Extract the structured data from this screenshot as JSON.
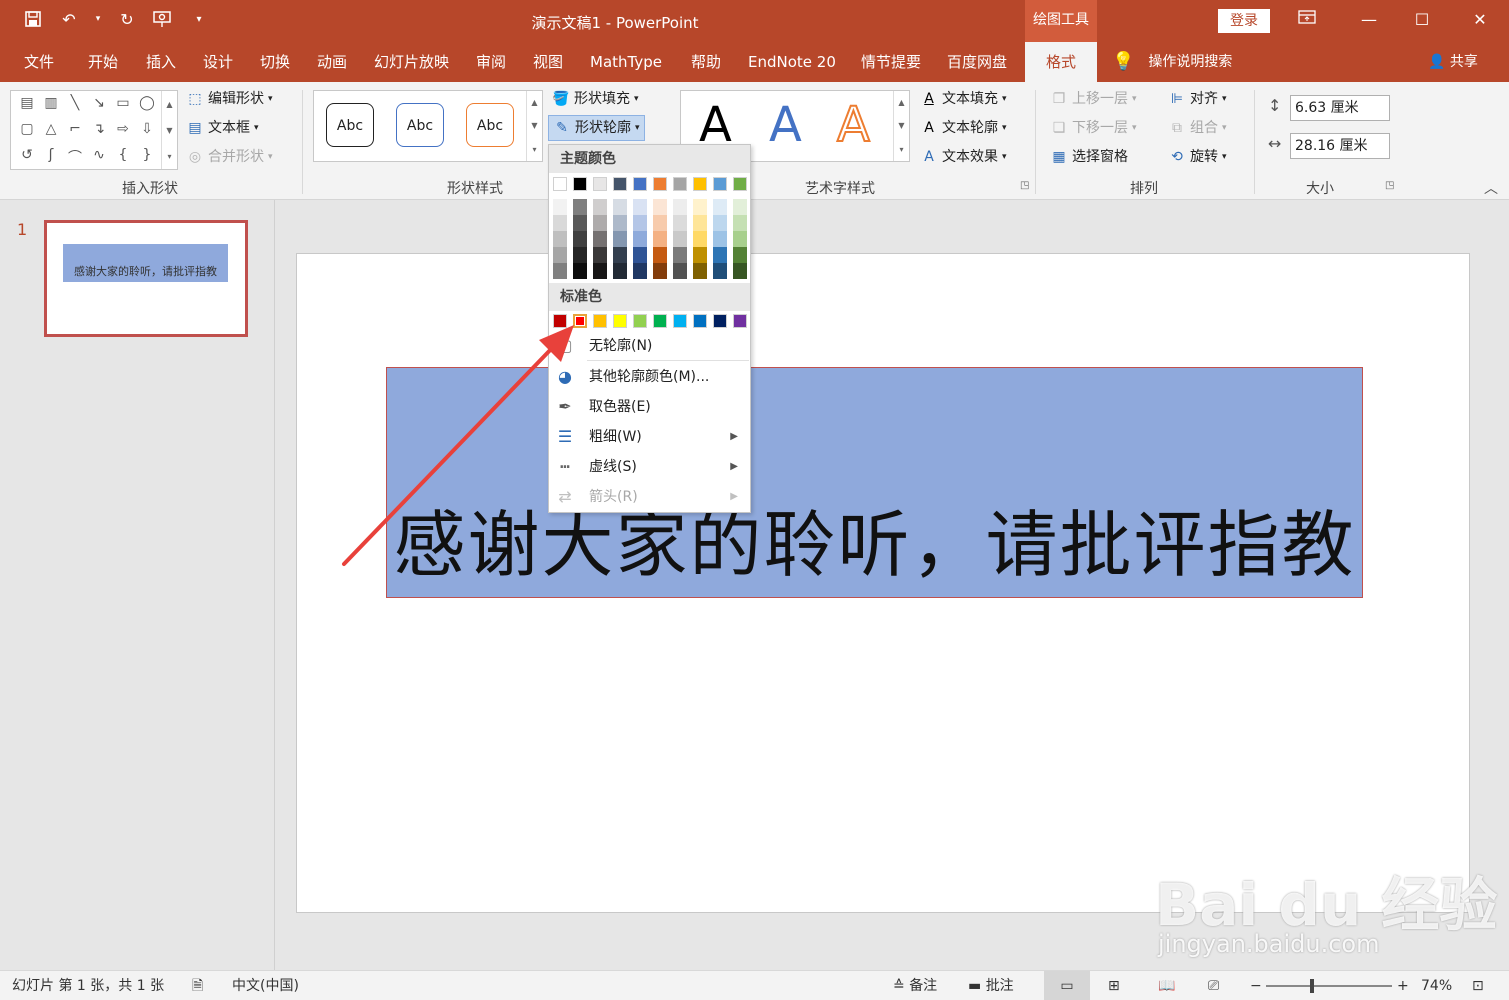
{
  "titlebar": {
    "title": "演示文稿1  -  PowerPoint",
    "context_tab_title": "绘图工具",
    "login": "登录"
  },
  "tabs": [
    "文件",
    "开始",
    "插入",
    "设计",
    "切换",
    "动画",
    "幻灯片放映",
    "审阅",
    "视图",
    "MathType",
    "帮助",
    "EndNote 20",
    "情节提要",
    "百度网盘",
    "格式"
  ],
  "active_tab": "格式",
  "tell_me": "操作说明搜索",
  "share": "共享",
  "ribbon": {
    "insert_shapes": {
      "label": "插入形状",
      "edit_shape": "编辑形状",
      "text_box": "文本框",
      "merge_shapes": "合并形状"
    },
    "shape_styles": {
      "label": "形状样式",
      "preset": "Abc",
      "fill": "形状填充",
      "outline": "形状轮廓"
    },
    "wordart": {
      "label": "艺术字样式",
      "letter": "A",
      "text_fill": "文本填充",
      "text_outline": "文本轮廓",
      "text_effects": "文本效果"
    },
    "arrange": {
      "label": "排列",
      "bring_forward": "上移一层",
      "send_backward": "下移一层",
      "selection_pane": "选择窗格",
      "align": "对齐",
      "group": "组合",
      "rotate": "旋转"
    },
    "size": {
      "label": "大小",
      "height": "6.63 厘米",
      "width": "28.16 厘米"
    }
  },
  "slides_pane": {
    "slide_number": "1",
    "thumb_text": "感谢大家的聆听，请批评指教"
  },
  "slide": {
    "text": "感谢大家的聆听，请批评指教"
  },
  "dropdown": {
    "theme_colors_header": "主题颜色",
    "standard_colors_header": "标准色",
    "theme_top": [
      "#ffffff",
      "#000000",
      "#e7e6e6",
      "#44546a",
      "#4472c4",
      "#ed7d31",
      "#a5a5a5",
      "#ffc000",
      "#5b9bd5",
      "#70ad47"
    ],
    "theme_shades": [
      [
        "#f2f2f2",
        "#d9d9d9",
        "#bfbfbf",
        "#a6a6a6",
        "#808080"
      ],
      [
        "#7f7f7f",
        "#595959",
        "#404040",
        "#262626",
        "#0d0d0d"
      ],
      [
        "#d0cece",
        "#aeabab",
        "#757171",
        "#3a3838",
        "#171616"
      ],
      [
        "#d6dce4",
        "#adb9ca",
        "#8497b0",
        "#333f4f",
        "#222a35"
      ],
      [
        "#d9e2f3",
        "#b4c6e7",
        "#8eaadb",
        "#2f5496",
        "#1f3864"
      ],
      [
        "#fbe5d5",
        "#f7cbac",
        "#f4b183",
        "#c55a11",
        "#833c0b"
      ],
      [
        "#ededed",
        "#dbdbdb",
        "#c9c9c9",
        "#7b7b7b",
        "#525252"
      ],
      [
        "#fff2cc",
        "#fee599",
        "#ffd966",
        "#bf9000",
        "#7f6000"
      ],
      [
        "#deebf6",
        "#bdd7ee",
        "#9dc3e6",
        "#2e75b5",
        "#1f4e79"
      ],
      [
        "#e2efd9",
        "#c5e0b3",
        "#a8d08d",
        "#548235",
        "#375623"
      ]
    ],
    "standard": [
      "#c00000",
      "#ff0000",
      "#ffc000",
      "#ffff00",
      "#92d050",
      "#00b050",
      "#00b0f0",
      "#0070c0",
      "#002060",
      "#7030a0"
    ],
    "selected_standard": "#ff0000",
    "items": {
      "no_outline": "无轮廓(N)",
      "more_colors": "其他轮廓颜色(M)...",
      "eyedropper": "取色器(E)",
      "weight": "粗细(W)",
      "dashes": "虚线(S)",
      "arrows": "箭头(R)"
    }
  },
  "statusbar": {
    "slide_info": "幻灯片 第 1 张，共 1 张",
    "language": "中文(中国)",
    "notes": "备注",
    "comments": "批注",
    "zoom_level": "74%"
  },
  "watermark": {
    "logo": "Bai du 经验",
    "url": "jingyan.baidu.com"
  },
  "colors": {
    "accent": "#b7472a",
    "shape_fill": "#8fa9dc",
    "annotation_arrow": "#e8413b"
  }
}
